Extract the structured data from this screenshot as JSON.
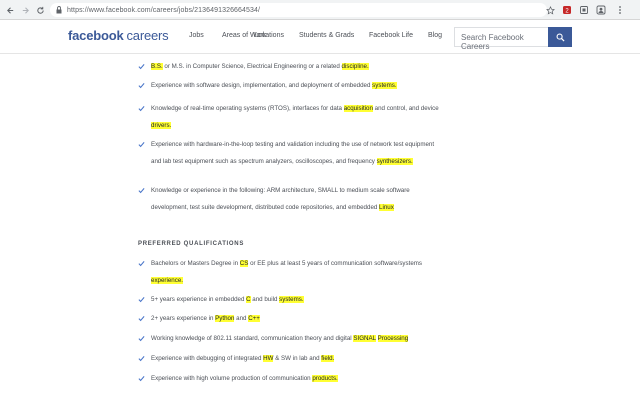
{
  "browser": {
    "url": "https://www.facebook.com/careers/jobs/2136491326664534/",
    "icons": [
      "back-icon",
      "forward-icon",
      "reload-icon",
      "lock-icon",
      "star-icon",
      "extension-icon",
      "menu-icon"
    ],
    "extension_badge": "2"
  },
  "header": {
    "logo_brand": "facebook",
    "logo_suffix": "careers",
    "nav": [
      "Jobs",
      "Areas of Work",
      "Locations",
      "Students & Grads",
      "Facebook Life",
      "Blog"
    ],
    "search_placeholder": "Search Facebook Careers"
  },
  "colors": {
    "brand": "#3b5998",
    "highlight": "#ffff33",
    "check": "#4a76c9",
    "text": "#4b4f56"
  },
  "minimum_qualifications": [
    [
      {
        "t": "B.S.",
        "h": true
      },
      {
        "t": " or M.S. in Computer Science, Electrical Engineering or a related "
      },
      {
        "t": "discipline.",
        "h": true
      }
    ],
    [
      {
        "t": "Experience with software design, implementation, and deployment of embedded "
      },
      {
        "t": "systems.",
        "h": true
      }
    ],
    [
      {
        "t": "Knowledge of real-time operating systems (RTOS), interfaces for data "
      },
      {
        "t": "acquisition",
        "h": true
      },
      {
        "t": " and control, and device "
      },
      {
        "t": "drivers.",
        "h": true
      }
    ],
    [
      {
        "t": "Experience with hardware-in-the-loop testing and validation including the use of network test equipment and lab test equipment such as spectrum analyzers, oscilloscopes, and frequency "
      },
      {
        "t": "synthesizers.",
        "h": true
      }
    ],
    [
      {
        "t": "Knowledge or experience in the following: ARM architecture, SMALL to medium scale software development, test suite development, distributed code repositories, and embedded "
      },
      {
        "t": "Linux",
        "h": true
      }
    ]
  ],
  "preferred_title": "PREFERRED QUALIFICATIONS",
  "preferred_qualifications": [
    [
      {
        "t": "Bachelors or Masters Degree in "
      },
      {
        "t": "CS",
        "h": true
      },
      {
        "t": " or EE plus at least 5 years of communication software/systems "
      },
      {
        "t": "experience.",
        "h": true
      }
    ],
    [
      {
        "t": "5+ years experience in embedded "
      },
      {
        "t": "C",
        "h": true
      },
      {
        "t": " and build "
      },
      {
        "t": "systems.",
        "h": true
      }
    ],
    [
      {
        "t": "2+ years experience in "
      },
      {
        "t": "Python",
        "h": true
      },
      {
        "t": " and "
      },
      {
        "t": "C++",
        "h": true
      }
    ],
    [
      {
        "t": "Working knowledge of 802.11 standard, communication theory and digital "
      },
      {
        "t": "SIGNAL",
        "h": true
      },
      {
        "t": " "
      },
      {
        "t": "Processing",
        "h": true
      }
    ],
    [
      {
        "t": "Experience with debugging of integrated "
      },
      {
        "t": "HW",
        "h": true
      },
      {
        "t": " & SW in lab and "
      },
      {
        "t": "field.",
        "h": true
      }
    ],
    [
      {
        "t": "Experience with high volume production of communication "
      },
      {
        "t": "products.",
        "h": true
      }
    ]
  ]
}
